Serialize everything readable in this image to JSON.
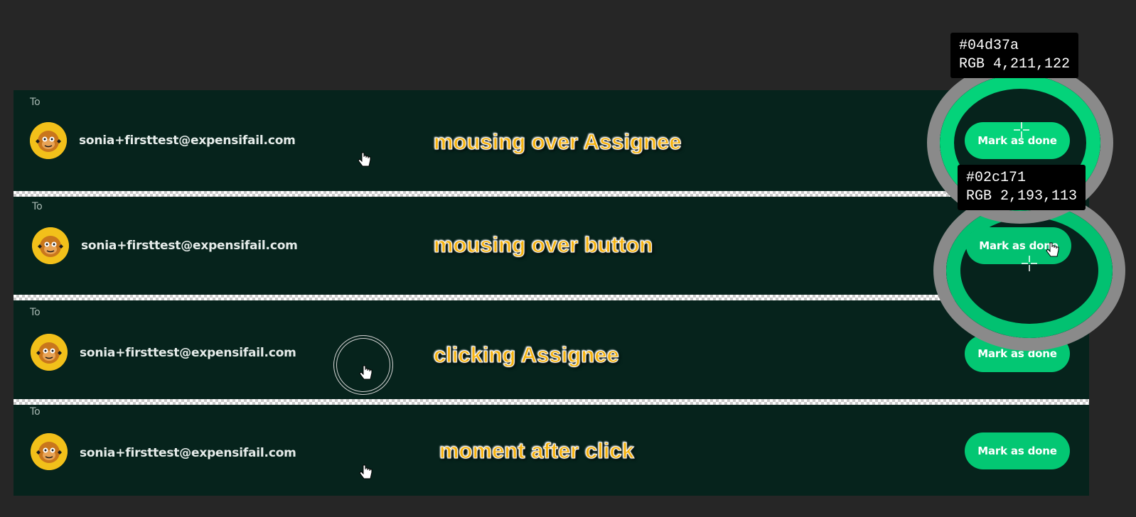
{
  "rows": [
    {
      "to_label": "To",
      "email": "sonia+firsttest@expensifail.com",
      "annotation": "mousing over Assignee",
      "button_label": "Mark as done",
      "button_color": "#04d37a"
    },
    {
      "to_label": "To",
      "email": "sonia+firsttest@expensifail.com",
      "annotation": "mousing over button",
      "button_label": "Mark as done",
      "button_color": "#02c171"
    },
    {
      "to_label": "To",
      "email": "sonia+firsttest@expensifail.com",
      "annotation": "clicking Assignee",
      "button_label": "Mark as done",
      "button_color": "#03c773"
    },
    {
      "to_label": "To",
      "email": "sonia+firsttest@expensifail.com",
      "annotation": "moment after click",
      "button_label": "Mark as done",
      "button_color": "#03c773"
    }
  ],
  "color_samples": [
    {
      "hex": "#04d37a",
      "rgb": "RGB 4,211,122"
    },
    {
      "hex": "#02c171",
      "rgb": "RGB 2,193,113"
    }
  ],
  "icons": {
    "avatar": "cartoon-monkey-avatar-icon",
    "cursor": "hand-pointer-icon",
    "crosshair": "crosshair-icon"
  }
}
